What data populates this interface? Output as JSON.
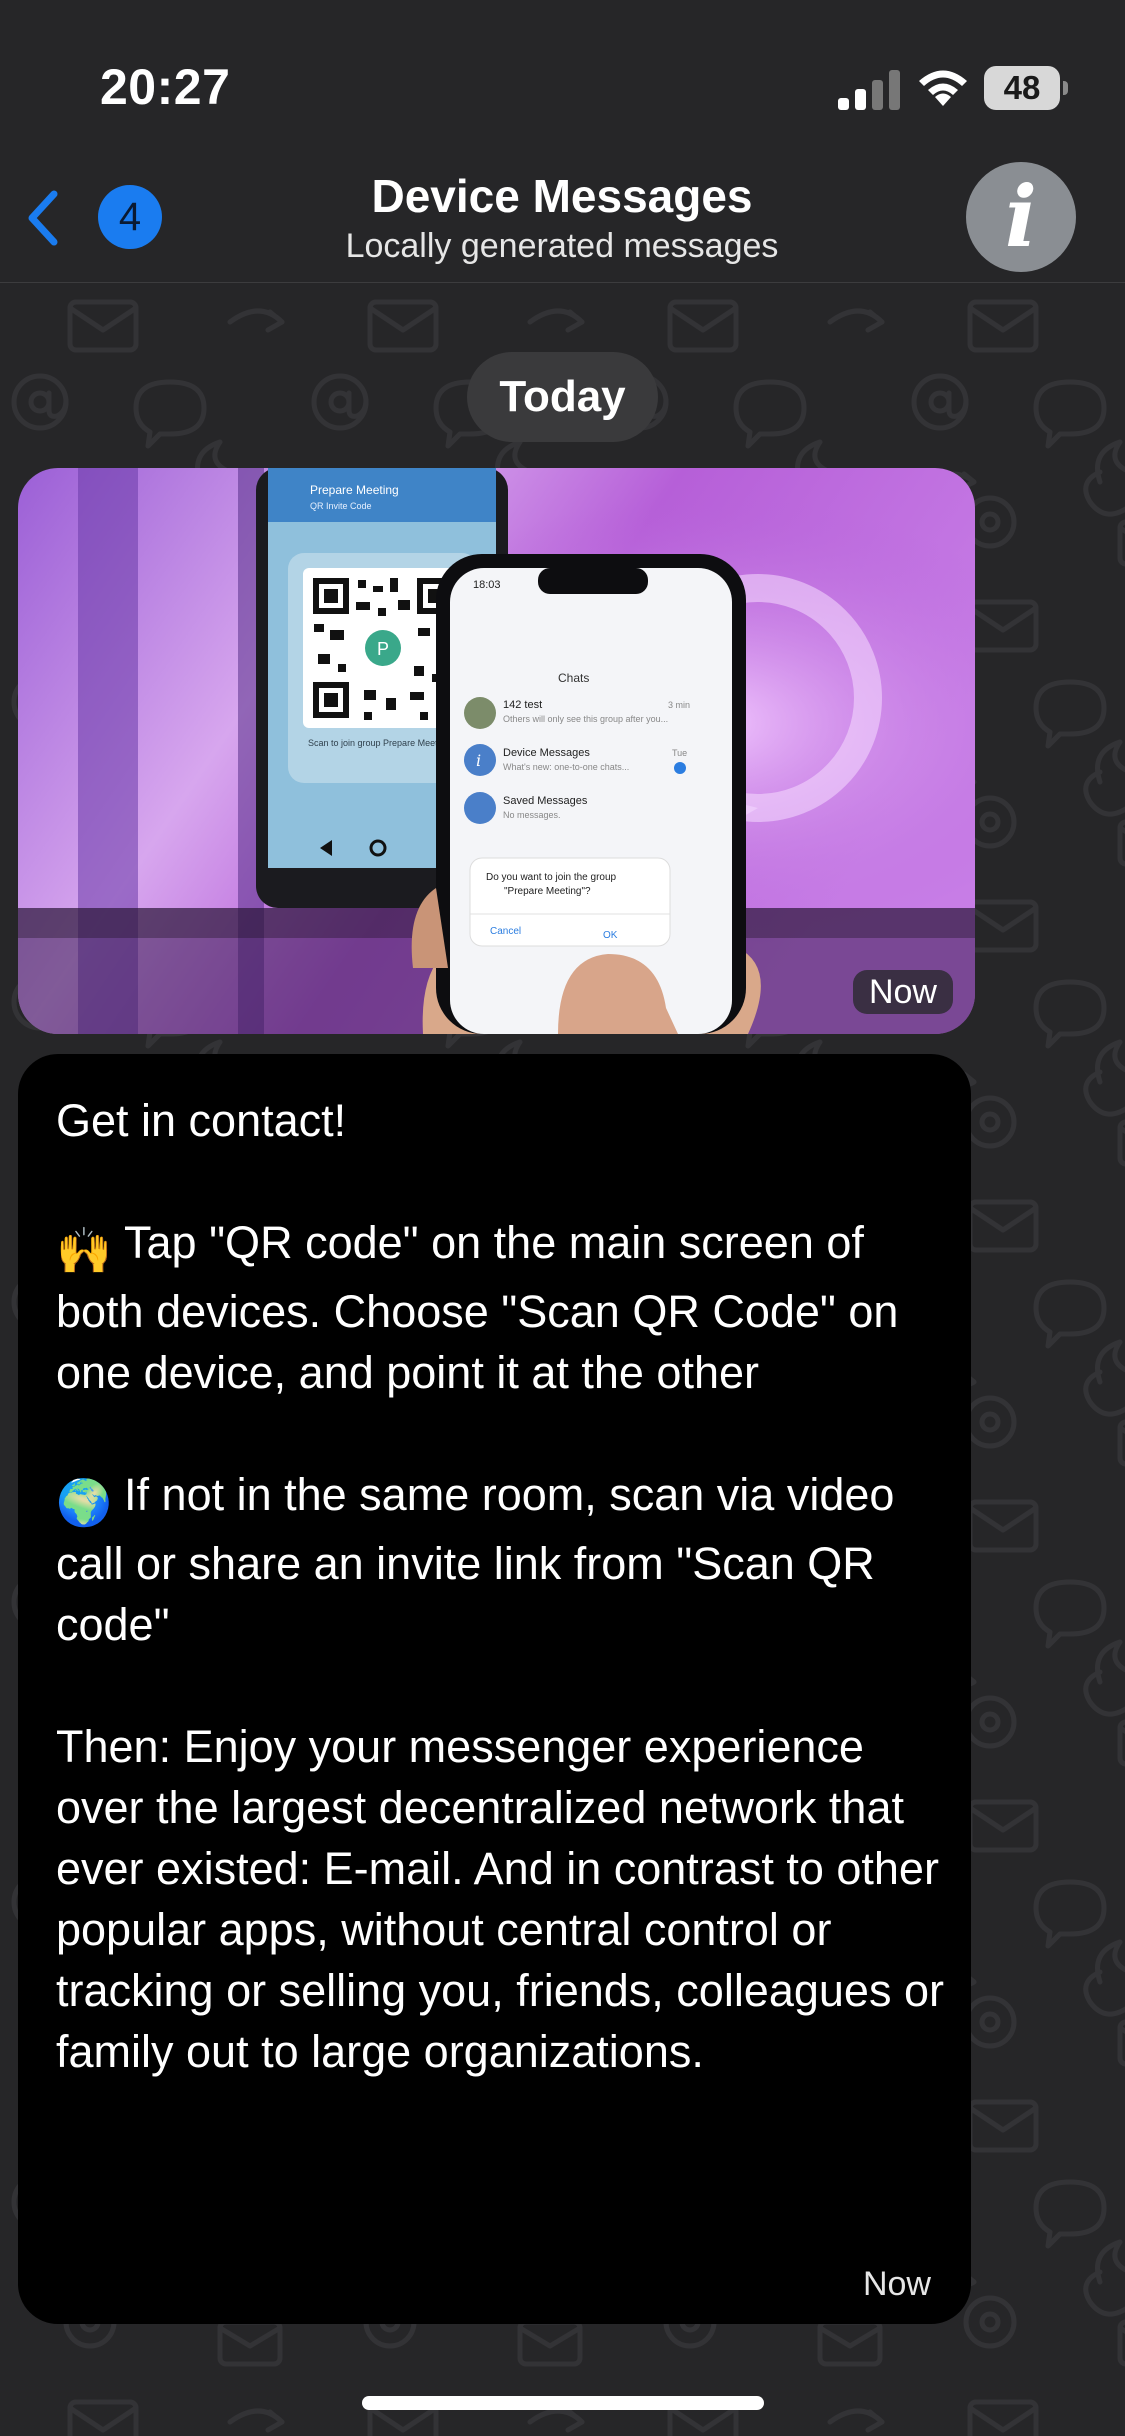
{
  "status_bar": {
    "time": "20:27",
    "battery_level": "48",
    "signal_icon": "cellular-signal-icon",
    "wifi_icon": "wifi-icon"
  },
  "nav": {
    "back_icon": "chevron-left-icon",
    "unread_count": "4",
    "title": "Device Messages",
    "subtitle": "Locally generated messages",
    "avatar_glyph": "i",
    "accent_color": "#1a7cf0"
  },
  "chat": {
    "date_separator": "Today",
    "image_message": {
      "time": "Now",
      "photo_texts": {
        "back_phone_title": "Prepare Meeting",
        "back_phone_subtitle": "QR Invite Code",
        "back_phone_caption": "Scan to join group Prepare Meeting",
        "front_phone_time": "18:03",
        "front_phone_header": "Chats",
        "chat_1_name": "142 test",
        "chat_1_preview": "Others will only see this group after you...",
        "chat_1_time": "3 min",
        "chat_2_name": "Device Messages",
        "chat_2_preview": "What's new: one-to-one chats...",
        "chat_2_time": "Tue",
        "chat_3_name": "Saved Messages",
        "chat_3_preview": "No messages.",
        "dialog_text_1": "Do you want to join the group",
        "dialog_text_2": "\"Prepare Meeting\"?",
        "dialog_cancel": "Cancel",
        "dialog_ok": "OK"
      }
    },
    "text_message": {
      "time": "Now",
      "p1": "Get in contact!",
      "p2_emoji": "🙌",
      "p2": "Tap \"QR code\" on the main screen of both devices. Choose \"Scan QR Code\" on one device, and point it at the other",
      "p3_emoji": "🌍",
      "p3": "If not in the same room, scan via video call or share an invite link from \"Scan QR code\"",
      "p4": "Then: Enjoy your messenger experience over the largest decentralized network that ever existed: E-mail. And in contrast to other popular apps, without central control or tracking or selling you, friends, colleagues or family out to large organizations."
    }
  }
}
